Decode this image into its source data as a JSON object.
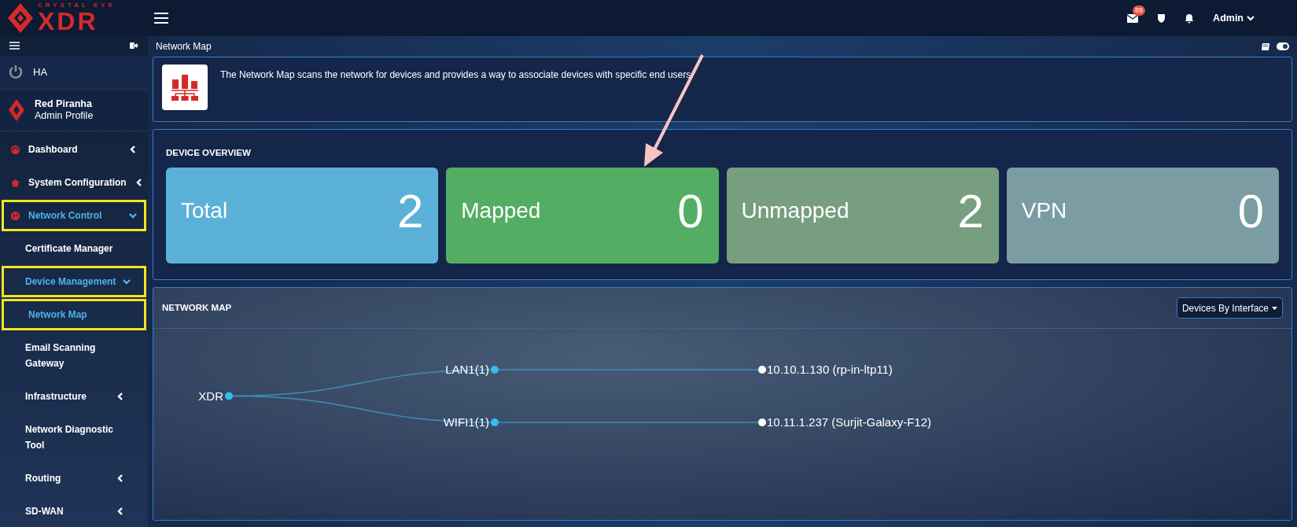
{
  "logo": {
    "top": "CRYSTAL EYE",
    "main": "XDR"
  },
  "topbar": {
    "mail_badge": "89",
    "user": "Admin"
  },
  "sidebar": {
    "ha": "HA",
    "profile": {
      "name": "Red Piranha",
      "role": "Admin Profile"
    },
    "items": [
      {
        "label": "Dashboard",
        "kind": "icon",
        "expanded": false,
        "active": false,
        "highlighted": false
      },
      {
        "label": "System Configuration",
        "kind": "icon",
        "expanded": false,
        "active": false,
        "highlighted": false
      },
      {
        "label": "Network Control",
        "kind": "icon",
        "expanded": true,
        "active": true,
        "highlighted": true,
        "children": [
          {
            "label": "Certificate Manager",
            "active": false,
            "highlighted": false
          },
          {
            "label": "Device Management",
            "expanded": true,
            "active": true,
            "highlighted": true,
            "children": [
              {
                "label": "Network Map",
                "active": true,
                "highlighted": true
              }
            ]
          },
          {
            "label": "Email Scanning Gateway",
            "active": false,
            "highlighted": false
          },
          {
            "label": "Infrastructure",
            "expanded": false,
            "active": false,
            "highlighted": false
          },
          {
            "label": "Network Diagnostic Tool",
            "active": false,
            "highlighted": false
          },
          {
            "label": "Routing",
            "expanded": false,
            "active": false,
            "highlighted": false
          },
          {
            "label": "SD-WAN",
            "expanded": false,
            "active": false,
            "highlighted": false
          }
        ]
      }
    ]
  },
  "page": {
    "title": "Network Map",
    "info": "The Network Map scans the network for devices and provides a way to associate devices with specific end users."
  },
  "device_overview": {
    "title": "DEVICE OVERVIEW",
    "cards": [
      {
        "label": "Total",
        "count": "2",
        "color": "#5bb0d8"
      },
      {
        "label": "Mapped",
        "count": "0",
        "color": "#53ad63"
      },
      {
        "label": "Unmapped",
        "count": "2",
        "color": "#789e80"
      },
      {
        "label": "VPN",
        "count": "0",
        "color": "#7a9ca2"
      }
    ]
  },
  "network_map": {
    "title": "NETWORK MAP",
    "view": "Devices By Interface",
    "tree": {
      "label": "XDR",
      "children": [
        {
          "label": "LAN1(1)",
          "children": [
            {
              "label": "10.10.1.130 (rp-in-ltp11)"
            }
          ]
        },
        {
          "label": "WIFI1(1)",
          "children": [
            {
              "label": "10.11.1.237 (Surjit-Galaxy-F12)"
            }
          ]
        }
      ]
    }
  }
}
